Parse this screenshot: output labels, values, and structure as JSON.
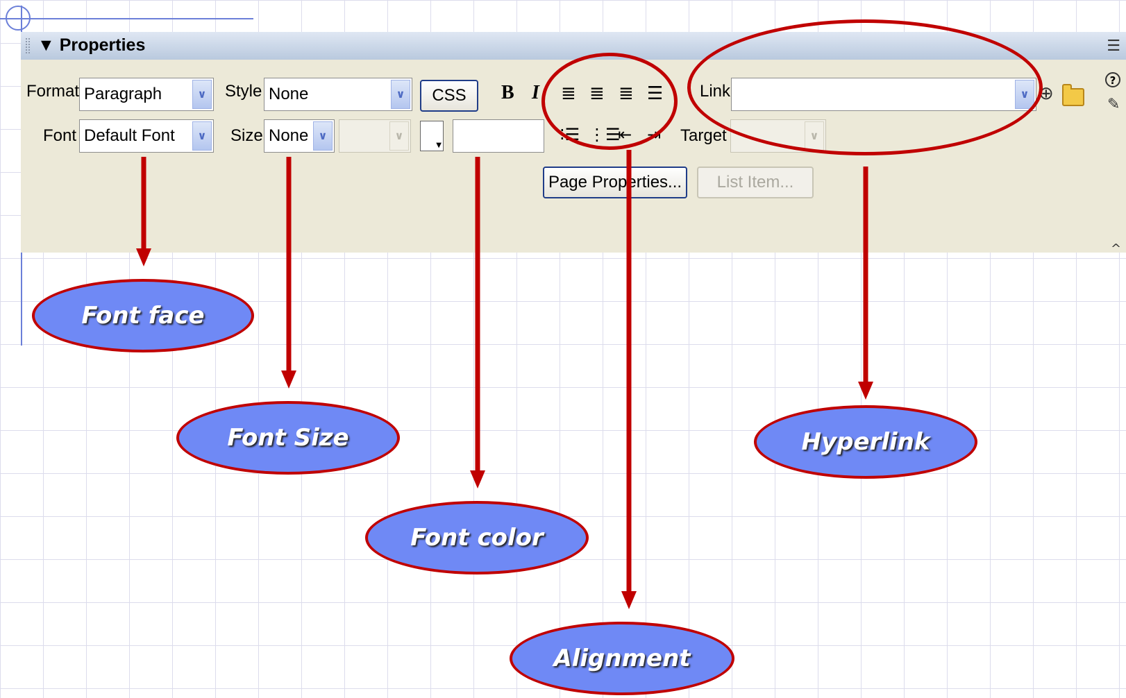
{
  "panel": {
    "title": "Properties",
    "collapse_glyph": "▼"
  },
  "row1": {
    "format_label": "Format",
    "format_value": "Paragraph",
    "style_label": "Style",
    "style_value": "None",
    "css_button": "CSS",
    "bold_button": "B",
    "italic_button": "I",
    "link_label": "Link",
    "link_value": ""
  },
  "row2": {
    "font_label": "Font",
    "font_value": "Default Font",
    "size_label": "Size",
    "size_value": "None",
    "target_label": "Target"
  },
  "row3": {
    "page_properties_button": "Page Properties...",
    "list_item_button": "List Item..."
  },
  "icons": {
    "align_left": "align-left-icon",
    "align_center": "align-center-icon",
    "align_right": "align-right-icon",
    "justify": "justify-icon",
    "unordered_list": "unordered-list-icon",
    "ordered_list": "ordered-list-icon",
    "text_outdent": "text-outdent-icon",
    "text_indent": "text-indent-icon",
    "point_to_file": "point-to-file-icon",
    "browse_folder": "folder-icon",
    "help": "help-icon",
    "quick_tag_editor": "edit-icon",
    "panel_options": "options-menu-icon"
  },
  "callouts": {
    "font_face": "Font face",
    "font_size": "Font Size",
    "font_color": "Font color",
    "alignment": "Alignment",
    "hyperlink": "Hyperlink"
  },
  "colors": {
    "callout_fill": "#6f89f5",
    "annotation_red": "#c00000",
    "panel_bg": "#ece9d8",
    "header_blue": "#c3d1e6"
  }
}
